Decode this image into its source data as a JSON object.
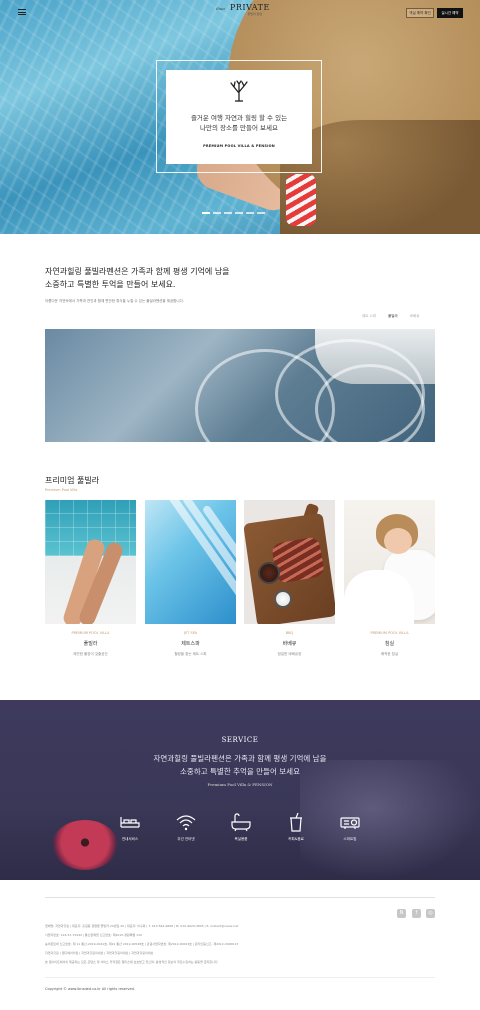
{
  "header": {
    "menu_icon": "hamburger-icon",
    "logo_small": "ihuo",
    "logo_main": "PRIVATE",
    "logo_sub": "풀빌라·펜션",
    "check_label": "객실 예약 확인",
    "book_label": "실시간 예약"
  },
  "hero": {
    "line1": "즐거운 여행 자연과 힐링 할 수 있는",
    "line2": "나만의 장소를 만들어 보세요",
    "subtitle": "PREMIUM POOL VILLA & PENSION",
    "slide_count": 6,
    "active_slide": 1
  },
  "intro": {
    "title_line1": "자연과힐링 풀빌라펜션은 가족과 함께 평생 기억에 남을",
    "title_line2": "소중하고 특별한 투억을 만들어 보세요.",
    "description": "아름다운 자연속에서 가족과 연인과 함께 편안한 휴식을 누릴 수 있는 풀빌라펜션을 제공합니다.",
    "tabs": [
      {
        "label": "제트 스파",
        "active": false
      },
      {
        "label": "풀빌라",
        "active": true
      },
      {
        "label": "바베큐",
        "active": false
      }
    ]
  },
  "premium": {
    "title": "프리미엄 풀빌라",
    "subtitle": "Premium Pool Villa",
    "cards": [
      {
        "category": "PREMIUM POOL VILLA",
        "name": "풀빌라",
        "desc": "깨끗한 풀장이 갖출공간"
      },
      {
        "category": "JET SPA",
        "name": "제트스파",
        "desc": "힐링을 찾는 제트 스파"
      },
      {
        "category": "BBQ",
        "name": "바베큐",
        "desc": "정갈한 바베큐장"
      },
      {
        "category": "PREMIUM POOL VILLA",
        "name": "침실",
        "desc": "쾌적한 침실"
      }
    ]
  },
  "service": {
    "title": "SERVICE",
    "line1": "자연과힐링 풀빌라펜션은 가족과 함께 평생 기억에 남을",
    "line2": "소중하고 특별한 추억을 만들어 보세요",
    "subtitle": "Premium Pool Villa & PENSION",
    "items": [
      {
        "label": "안내서비스",
        "icon": "bed-icon"
      },
      {
        "label": "무선 인터넷",
        "icon": "wifi-icon"
      },
      {
        "label": "욕실용품",
        "icon": "bathtub-icon"
      },
      {
        "label": "커피&음료",
        "icon": "coffee-cup-icon"
      },
      {
        "label": "스마트빔",
        "icon": "projector-icon"
      }
    ]
  },
  "footer": {
    "sns": [
      {
        "icon": "naver-blog-icon",
        "glyph": "N"
      },
      {
        "icon": "facebook-icon",
        "glyph": "f"
      },
      {
        "icon": "instagram-icon",
        "glyph": "◎"
      }
    ],
    "info1": "업체명: 자연과힐링 | 대표자: 홍길동 정말펜 풀빌라 20번길 20 | 대표자: 이수화 | T. 010-562-9898 | M. 010-9029-4845 | E. mdkart@naver.net",
    "info2": "사업자번호: 124-57-75442 | 통신판매업 신고번호: 제2015-경원특별 132",
    "info3": "농어촌민박 신고번호: 제 11 통산-2019-0041호, 제21 통산 2012-00548호 | 관광사업자번호: 제2012-00004호 | 온라인등신고: 제2012-0000013",
    "info4": "자연과힐링 | 웹디에이치월 | 자연과힐링의세상 | 자연과힐링의세상 | 자연과힐링의세상",
    "info5": "본 웹사이트에서의 제공되는 모든 콘텐츠 및 서비스 저작권은 웹리츠에 보호받고 있으며, 활성적인 정보의 무단수집하는 활동을 금지합니다",
    "copyright": "Copyright © www.ibnsded.co.kr All rights reserved."
  },
  "colors": {
    "accent_gold": "#c19a6b",
    "service_bg": "#3d3a5e",
    "dark": "#111111"
  }
}
